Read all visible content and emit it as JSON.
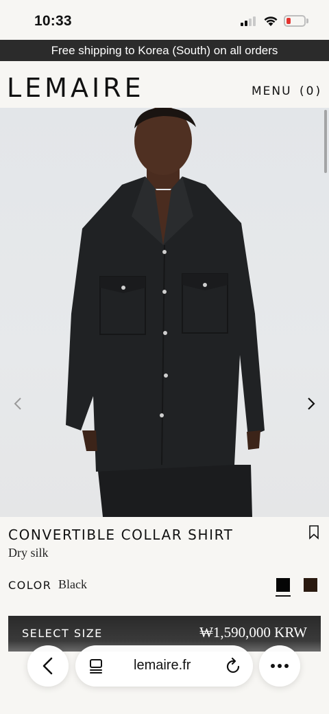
{
  "status_bar": {
    "time": "10:33"
  },
  "promo": {
    "text": "Free shipping to Korea (South) on all orders"
  },
  "header": {
    "logo": "LEMAIRE",
    "menu_label": "MENU",
    "cart_label": "(0)"
  },
  "product": {
    "title": "CONVERTIBLE COLLAR SHIRT",
    "subtitle": "Dry silk",
    "color_label": "COLOR",
    "color_value": "Black",
    "swatches": [
      {
        "name": "Black",
        "color": "#050505",
        "selected": true
      },
      {
        "name": "Brown",
        "color": "#2a1a10",
        "selected": false
      }
    ],
    "size_label": "SELECT SIZE",
    "price": "₩1,590,000 KRW"
  },
  "browser": {
    "url": "lemaire.fr"
  },
  "icons": {
    "carousel_prev": "chevron-left-icon",
    "carousel_next": "chevron-right-icon",
    "bookmark": "bookmark-icon",
    "back": "chevron-left-icon",
    "tabs": "tabs-icon",
    "reload": "reload-icon",
    "more": "ellipsis-icon"
  }
}
